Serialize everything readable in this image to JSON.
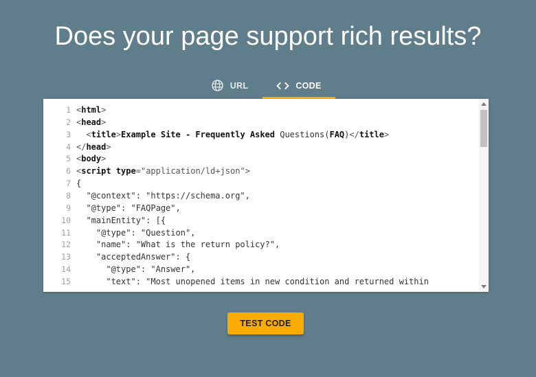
{
  "page": {
    "title": "Does your page support rich results?"
  },
  "tabs": [
    {
      "label": "URL",
      "icon": "globe-icon",
      "selected": false
    },
    {
      "label": "CODE",
      "icon": "code-brackets-icon",
      "selected": true
    }
  ],
  "editor": {
    "lines": [
      {
        "no": "1",
        "tokens": [
          [
            "punct",
            "<"
          ],
          [
            "tag",
            "html"
          ],
          [
            "punct",
            ">"
          ]
        ]
      },
      {
        "no": "2",
        "tokens": [
          [
            "punct",
            "<"
          ],
          [
            "tag",
            "head"
          ],
          [
            "punct",
            ">"
          ]
        ]
      },
      {
        "no": "3",
        "tokens": [
          [
            "plain",
            "  "
          ],
          [
            "punct",
            "<"
          ],
          [
            "tag",
            "title"
          ],
          [
            "punct",
            ">"
          ],
          [
            "tag",
            "Example Site - Frequently Asked "
          ],
          [
            "plain",
            "Questions("
          ],
          [
            "tag",
            "FAQ"
          ],
          [
            "plain",
            ")"
          ],
          [
            "punct",
            "</"
          ],
          [
            "tag",
            "title"
          ],
          [
            "punct",
            ">"
          ]
        ]
      },
      {
        "no": "4",
        "tokens": [
          [
            "punct",
            "</"
          ],
          [
            "tag",
            "head"
          ],
          [
            "punct",
            ">"
          ]
        ]
      },
      {
        "no": "5",
        "tokens": [
          [
            "punct",
            "<"
          ],
          [
            "tag",
            "body"
          ],
          [
            "punct",
            ">"
          ]
        ]
      },
      {
        "no": "6",
        "tokens": [
          [
            "punct",
            "<"
          ],
          [
            "tag",
            "script"
          ],
          [
            "plain",
            " "
          ],
          [
            "attr",
            "type"
          ],
          [
            "punct",
            "="
          ],
          [
            "str",
            "\"application/ld+json\""
          ],
          [
            "punct",
            ">"
          ]
        ]
      },
      {
        "no": "7",
        "tokens": [
          [
            "plain",
            "{"
          ]
        ]
      },
      {
        "no": "8",
        "tokens": [
          [
            "plain",
            "  \"@context\": \"https://schema.org\","
          ]
        ]
      },
      {
        "no": "9",
        "tokens": [
          [
            "plain",
            "  \"@type\": \"FAQPage\","
          ]
        ]
      },
      {
        "no": "10",
        "tokens": [
          [
            "plain",
            "  \"mainEntity\": [{"
          ]
        ]
      },
      {
        "no": "11",
        "tokens": [
          [
            "plain",
            "    \"@type\": \"Question\","
          ]
        ]
      },
      {
        "no": "12",
        "tokens": [
          [
            "plain",
            "    \"name\": \"What is the return policy?\","
          ]
        ]
      },
      {
        "no": "13",
        "tokens": [
          [
            "plain",
            "    \"acceptedAnswer\": {"
          ]
        ]
      },
      {
        "no": "14",
        "tokens": [
          [
            "plain",
            "      \"@type\": \"Answer\","
          ]
        ]
      },
      {
        "no": "15",
        "tokens": [
          [
            "plain",
            "      \"text\": \"Most unopened items in new condition and returned within"
          ]
        ]
      }
    ]
  },
  "actions": {
    "test_code_label": "TEST CODE"
  },
  "colors": {
    "background": "#607d8b",
    "accent": "#f9ab00",
    "editor_bg": "#ffffff"
  }
}
